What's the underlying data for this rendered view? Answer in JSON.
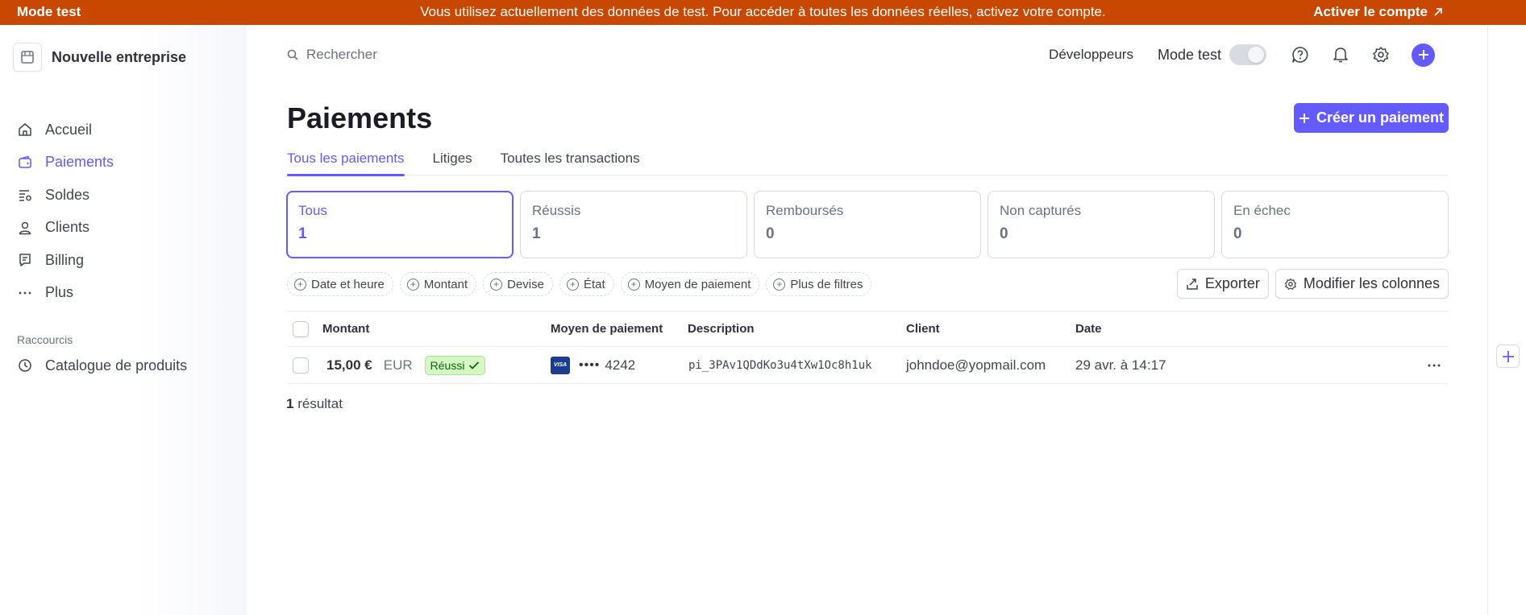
{
  "banner": {
    "mode": "Mode test",
    "message": "Vous utilisez actuellement des données de test. Pour accéder à toutes les données réelles, activez votre compte.",
    "activate": "Activer le compte"
  },
  "sidebar": {
    "company": "Nouvelle entreprise",
    "items": [
      {
        "label": "Accueil",
        "icon": "home-icon",
        "active": false
      },
      {
        "label": "Paiements",
        "icon": "wallet-icon",
        "active": true
      },
      {
        "label": "Soldes",
        "icon": "balances-icon",
        "active": false
      },
      {
        "label": "Clients",
        "icon": "user-icon",
        "active": false
      },
      {
        "label": "Billing",
        "icon": "billing-icon",
        "active": false
      },
      {
        "label": "Plus",
        "icon": "more-icon",
        "active": false
      }
    ],
    "shortcuts_title": "Raccourcis",
    "shortcuts": [
      {
        "label": "Catalogue de produits",
        "icon": "clock-icon"
      }
    ]
  },
  "topbar": {
    "search_placeholder": "Rechercher",
    "developers": "Développeurs",
    "test_mode_label": "Mode test"
  },
  "page": {
    "title": "Paiements",
    "create_button": "Créer un paiement",
    "tabs": [
      {
        "label": "Tous les paiements",
        "active": true
      },
      {
        "label": "Litiges",
        "active": false
      },
      {
        "label": "Toutes les transactions",
        "active": false
      }
    ],
    "status_cards": [
      {
        "label": "Tous",
        "count": "1",
        "active": true
      },
      {
        "label": "Réussis",
        "count": "1",
        "active": false
      },
      {
        "label": "Remboursés",
        "count": "0",
        "active": false
      },
      {
        "label": "Non capturés",
        "count": "0",
        "active": false
      },
      {
        "label": "En échec",
        "count": "0",
        "active": false
      }
    ],
    "filters": [
      "Date et heure",
      "Montant",
      "Devise",
      "État",
      "Moyen de paiement",
      "Plus de filtres"
    ],
    "export_button": "Exporter",
    "columns_button": "Modifier les colonnes"
  },
  "table": {
    "headers": {
      "amount": "Montant",
      "payment_method": "Moyen de paiement",
      "description": "Description",
      "client": "Client",
      "date": "Date"
    },
    "rows": [
      {
        "amount": "15,00 €",
        "currency": "EUR",
        "status": "Réussi",
        "card_brand": "VISA",
        "card_dots": "••••",
        "card_last4": "4242",
        "description": "pi_3PAv1QDdKo3u4tXw1Oc8h1uk",
        "client": "johndoe@yopmail.com",
        "date": "29 avr. à 14:17"
      }
    ]
  },
  "result": {
    "count": "1",
    "label": "résultat"
  },
  "colors": {
    "accent": "#635bff",
    "banner": "#c84801",
    "success_bg": "#d7f7c2",
    "success_text": "#05690d"
  }
}
